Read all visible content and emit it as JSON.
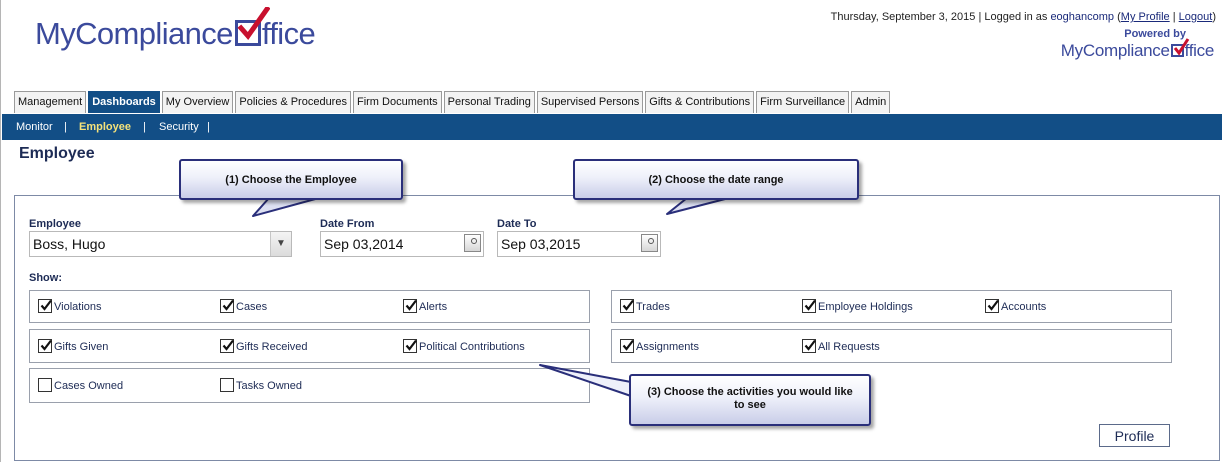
{
  "brand": {
    "logo_before": "MyCompliance",
    "logo_after": "ffice",
    "powered_by": "Powered by"
  },
  "topbar": {
    "date": "Thursday, September 3, 2015",
    "logged_in_prefix": "| Logged in as",
    "username": "eoghancomp",
    "my_profile": "My Profile",
    "logout": "Logout"
  },
  "tabs": [
    {
      "label": "Management",
      "active": false
    },
    {
      "label": "Dashboards",
      "active": true
    },
    {
      "label": "My Overview",
      "active": false
    },
    {
      "label": "Policies & Procedures",
      "active": false
    },
    {
      "label": "Firm Documents",
      "active": false
    },
    {
      "label": "Personal Trading",
      "active": false
    },
    {
      "label": "Supervised Persons",
      "active": false
    },
    {
      "label": "Gifts & Contributions",
      "active": false
    },
    {
      "label": "Firm Surveillance",
      "active": false
    },
    {
      "label": "Admin",
      "active": false
    }
  ],
  "subnav": [
    {
      "label": "Monitor",
      "active": false
    },
    {
      "label": "Employee",
      "active": true
    },
    {
      "label": "Security",
      "active": false
    }
  ],
  "page_title": "Employee",
  "form": {
    "employee_label": "Employee",
    "employee_value": "Boss, Hugo",
    "date_from_label": "Date From",
    "date_from_value": "Sep 03,2014",
    "date_to_label": "Date To",
    "date_to_value": "Sep 03,2015",
    "show_label": "Show:"
  },
  "checkboxes": [
    {
      "label": "Violations",
      "checked": true
    },
    {
      "label": "Cases",
      "checked": true
    },
    {
      "label": "Alerts",
      "checked": true
    },
    {
      "label": "Gifts Given",
      "checked": true
    },
    {
      "label": "Gifts Received",
      "checked": true
    },
    {
      "label": "Political Contributions",
      "checked": true
    },
    {
      "label": "Cases Owned",
      "checked": false
    },
    {
      "label": "Tasks Owned",
      "checked": false
    },
    {
      "label": "Trades",
      "checked": true
    },
    {
      "label": "Employee Holdings",
      "checked": true
    },
    {
      "label": "Accounts",
      "checked": true
    },
    {
      "label": "Assignments",
      "checked": true
    },
    {
      "label": "All Requests",
      "checked": true
    }
  ],
  "profile_button": "Profile",
  "callouts": {
    "c1": "(1) Choose the Employee",
    "c2": "(2) Choose the date range",
    "c3": "(3) Choose the activities you would like to see"
  },
  "colors": {
    "nav": "#124e86",
    "brand": "#3b4a9c",
    "check_red": "#c8102e",
    "active_subnav": "#f5e27a"
  },
  "icons": {
    "dropdown": "chevron-down-icon",
    "calendar": "calendar-icon",
    "logo_check": "checkmark-icon"
  }
}
